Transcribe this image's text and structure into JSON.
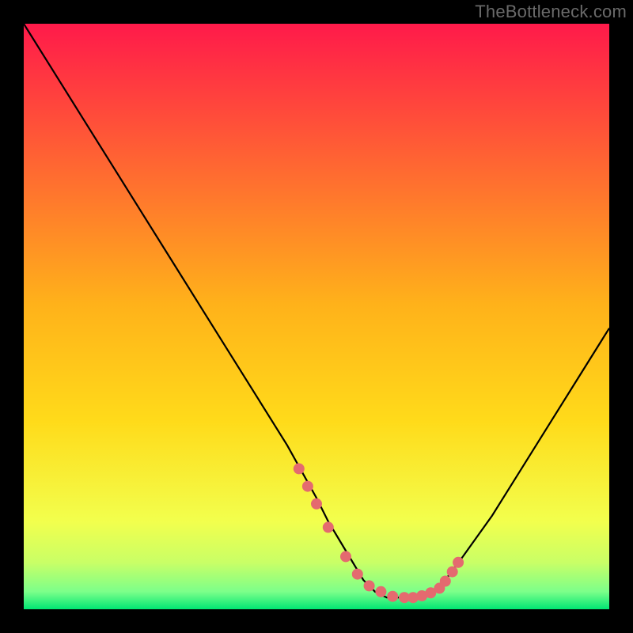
{
  "watermark": "TheBottleneck.com",
  "colors": {
    "background": "#000000",
    "gradient_top": "#ff1a4a",
    "gradient_mid": "#ffdb1a",
    "gradient_low": "#dfff60",
    "gradient_bottom": "#00e673",
    "curve": "#000000",
    "marker": "#e46a6f"
  },
  "chart_data": {
    "type": "line",
    "title": "",
    "xlabel": "",
    "ylabel": "",
    "xlim": [
      0,
      100
    ],
    "ylim": [
      0,
      100
    ],
    "grid": false,
    "legend": "none",
    "annotations": [],
    "series": [
      {
        "name": "curve",
        "x": [
          0,
          5,
          10,
          15,
          20,
          25,
          30,
          35,
          40,
          45,
          50,
          52,
          55,
          58,
          60,
          62,
          65,
          68,
          70,
          72,
          75,
          80,
          85,
          90,
          95,
          100
        ],
        "y": [
          100,
          92,
          84,
          76,
          68,
          60,
          52,
          44,
          36,
          28,
          19,
          15,
          10,
          5,
          3,
          2,
          2,
          2,
          3,
          5,
          9,
          16,
          24,
          32,
          40,
          48
        ]
      }
    ],
    "markers": {
      "name": "ideal-range-points",
      "x": [
        47,
        48.5,
        50,
        52,
        55,
        57,
        59,
        61,
        63,
        65,
        66.5,
        68,
        69.5,
        71,
        72,
        73.2,
        74.2
      ],
      "y": [
        24,
        21,
        18,
        14,
        9,
        6,
        4,
        3,
        2.2,
        2,
        2,
        2.3,
        2.8,
        3.6,
        4.8,
        6.4,
        8
      ]
    }
  }
}
